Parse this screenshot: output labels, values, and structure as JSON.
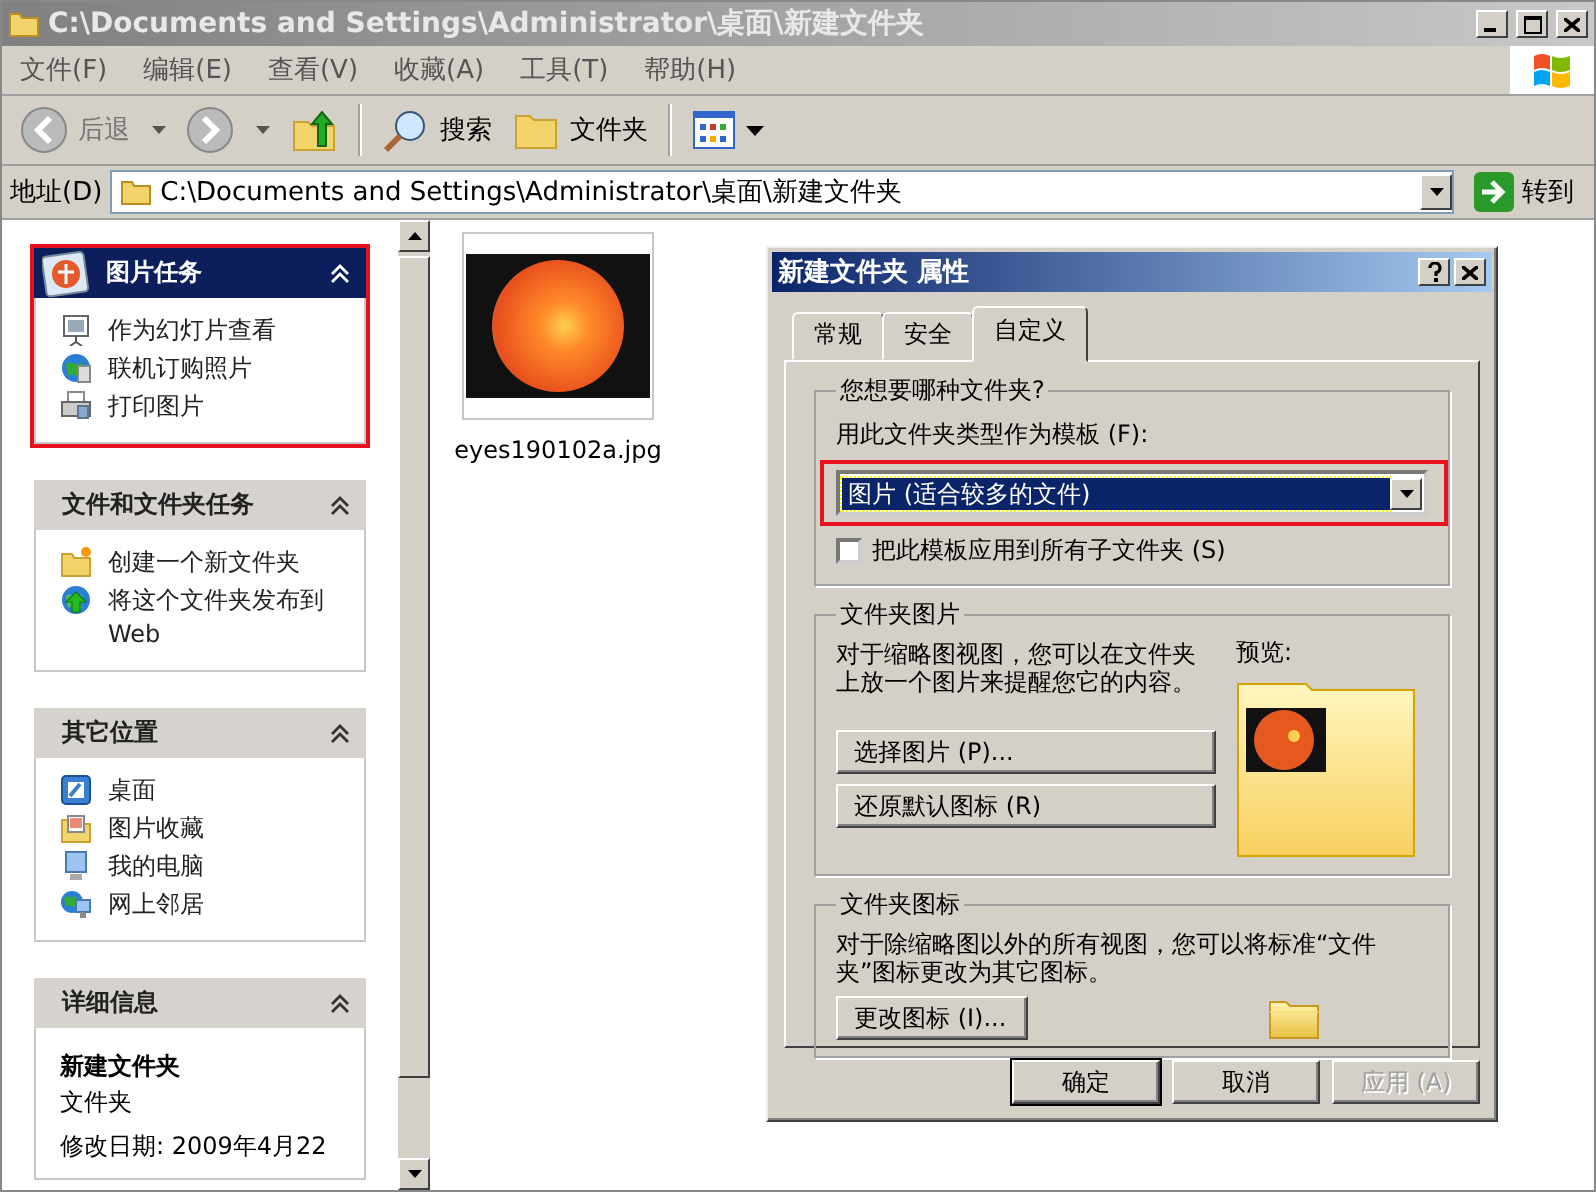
{
  "window": {
    "title": "C:\\Documents and Settings\\Administrator\\桌面\\新建文件夹"
  },
  "menu": [
    "文件(F)",
    "编辑(E)",
    "查看(V)",
    "收藏(A)",
    "工具(T)",
    "帮助(H)"
  ],
  "toolbar": [
    {
      "kind": "back",
      "label": "后退",
      "disabled": true
    },
    {
      "kind": "forward",
      "disabled": true
    },
    {
      "kind": "up"
    },
    {
      "kind": "search",
      "label": "搜索"
    },
    {
      "kind": "folders",
      "label": "文件夹"
    },
    {
      "kind": "views"
    }
  ],
  "address": {
    "label": "地址(D)",
    "value": "C:\\Documents and Settings\\Administrator\\桌面\\新建文件夹",
    "go": "转到"
  },
  "sidebar": [
    {
      "kind": "special",
      "title": "图片任务",
      "expanded": true,
      "highlighted": true,
      "items": [
        {
          "label": "作为幻灯片查看"
        },
        {
          "label": "联机订购照片"
        },
        {
          "label": "打印图片"
        }
      ]
    },
    {
      "kind": "tasks",
      "title": "文件和文件夹任务",
      "expanded": true,
      "highlighted": false,
      "items": [
        {
          "label": "创建一个新文件夹"
        },
        {
          "label": "将这个文件夹发布到 Web"
        }
      ]
    },
    {
      "kind": "tasks",
      "title": "其它位置",
      "expanded": true,
      "highlighted": false,
      "items": [
        {
          "label": "桌面"
        },
        {
          "label": "图片收藏"
        },
        {
          "label": "我的电脑"
        },
        {
          "label": "网上邻居"
        }
      ]
    },
    {
      "kind": "details",
      "title": "详细信息",
      "expanded": true,
      "highlighted": false,
      "name": "新建文件夹",
      "type": "文件夹",
      "modified": "修改日期: 2009年4月22"
    }
  ],
  "files": [
    {
      "name": "eyes190102a.jpg"
    }
  ],
  "dialog": {
    "title": "新建文件夹 属性",
    "tabs": [
      {
        "label": "常规",
        "selected": false
      },
      {
        "label": "安全",
        "selected": false
      },
      {
        "label": "自定义",
        "selected": true
      }
    ],
    "template_group": {
      "title": "您想要哪种文件夹?",
      "label": "用此文件夹类型作为模板 (F):",
      "template": {
        "value": "图片 (适合较多的文件)",
        "highlighted": true
      },
      "apply_to_subfolders": {
        "label": "把此模板应用到所有子文件夹 (S)",
        "checked": false
      }
    },
    "picture_group": {
      "title": "文件夹图片",
      "description": "对于缩略图视图，您可以在文件夹上放一个图片来提醒您它的内容。",
      "preview_label": "预览:",
      "buttons": [
        "选择图片 (P)...",
        "还原默认图标 (R)"
      ]
    },
    "icon_group": {
      "title": "文件夹图标",
      "description": "对于除缩略图以外的所有视图，您可以将标准“文件夹”图标更改为其它图标。",
      "buttons": [
        "更改图标 (I)..."
      ]
    },
    "buttons": [
      {
        "label": "确定",
        "default": true,
        "disabled": false
      },
      {
        "label": "取消",
        "default": false,
        "disabled": false
      },
      {
        "label": "应用 (A)",
        "default": false,
        "disabled": true
      }
    ]
  }
}
